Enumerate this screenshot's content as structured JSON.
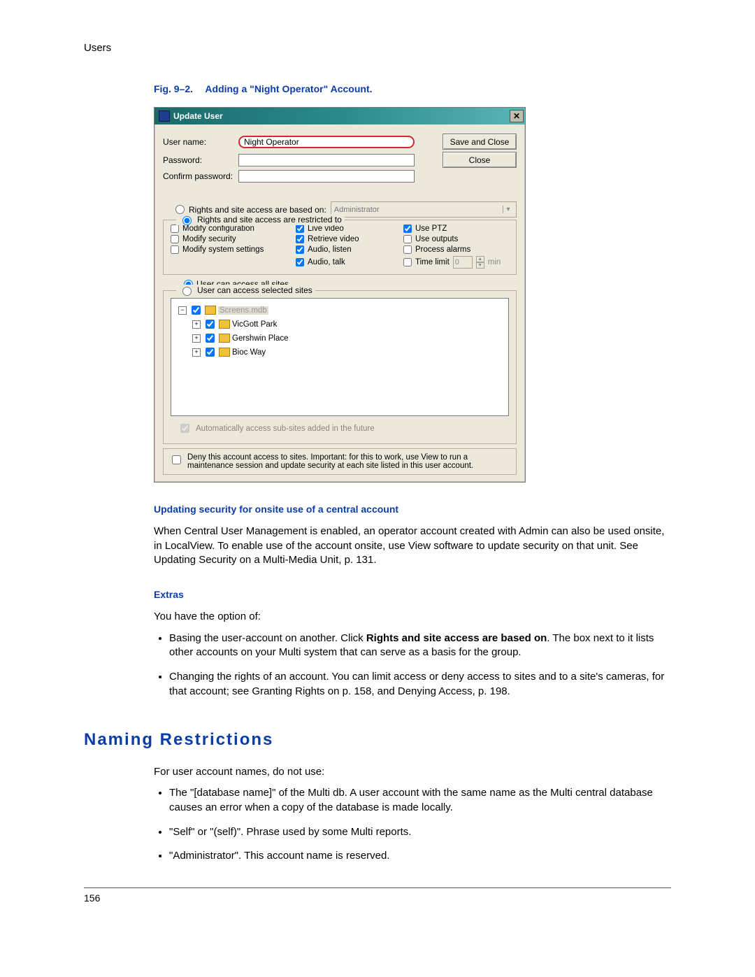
{
  "header": "Users",
  "figure": {
    "number": "Fig. 9–2.",
    "title": "Adding a \"Night Operator\" Account."
  },
  "dialog": {
    "title": "Update User",
    "labels": {
      "username": "User name:",
      "password": "Password:",
      "confirm": "Confirm password:"
    },
    "values": {
      "username": "Night Operator"
    },
    "buttons": {
      "save": "Save and Close",
      "close": "Close"
    },
    "based_on": {
      "radio_label": "Rights and site access are based on:",
      "selected": "Administrator"
    },
    "restricted_legend": "Rights and site access are restricted to",
    "rights": {
      "modify_config": "Modify configuration",
      "modify_security": "Modify security",
      "modify_system": "Modify system settings",
      "live_video": "Live video",
      "retrieve_video": "Retrieve video",
      "audio_listen": "Audio, listen",
      "audio_talk": "Audio, talk",
      "use_ptz": "Use PTZ",
      "use_outputs": "Use outputs",
      "process_alarms": "Process alarms",
      "time_limit_label": "Time limit",
      "time_limit_value": "0",
      "time_limit_unit": "min"
    },
    "site_access": {
      "all": "User can access all sites",
      "selected": "User can access selected sites"
    },
    "tree": {
      "root": "Screens.mdb",
      "items": [
        "VicGott Park",
        "Gershwin Place",
        "Bioc Way"
      ]
    },
    "auto_sub": "Automatically access sub-sites added in the future",
    "deny": "Deny this account access to sites. Important: for this to work, use View to run a maintenance session and update security at each site listed in this user account."
  },
  "sub1": {
    "heading": "Updating security for onsite use of a central account",
    "text": "When Central User Management is enabled, an operator account created with Admin can also be used onsite, in LocalView. To enable use of the account onsite, use View software to update security on that unit. See Updating Security on a Multi-Media Unit, p. 131."
  },
  "sub2": {
    "heading": "Extras",
    "intro": "You have the option of:",
    "bullet1_pre": "Basing the user-account on another. Click ",
    "bullet1_bold": "Rights and site access are based on",
    "bullet1_post": ". The box next to it lists other accounts on your Multi system that can serve as a basis for the group.",
    "bullet2": "Changing the rights of an account. You can limit access or deny access to sites and to a site's cameras, for that account; see Granting Rights on p. 158, and Denying Access, p. 198."
  },
  "section2": {
    "title": "Naming Restrictions",
    "intro": "For user account names, do not use:",
    "b1": "The \"[database name]\" of the Multi db. A user account with the same name as the Multi central database causes an error when a copy of the database is made locally.",
    "b2": "\"Self\" or \"(self)\". Phrase used by some Multi reports.",
    "b3": "\"Administrator\". This account name is reserved."
  },
  "page_number": "156"
}
